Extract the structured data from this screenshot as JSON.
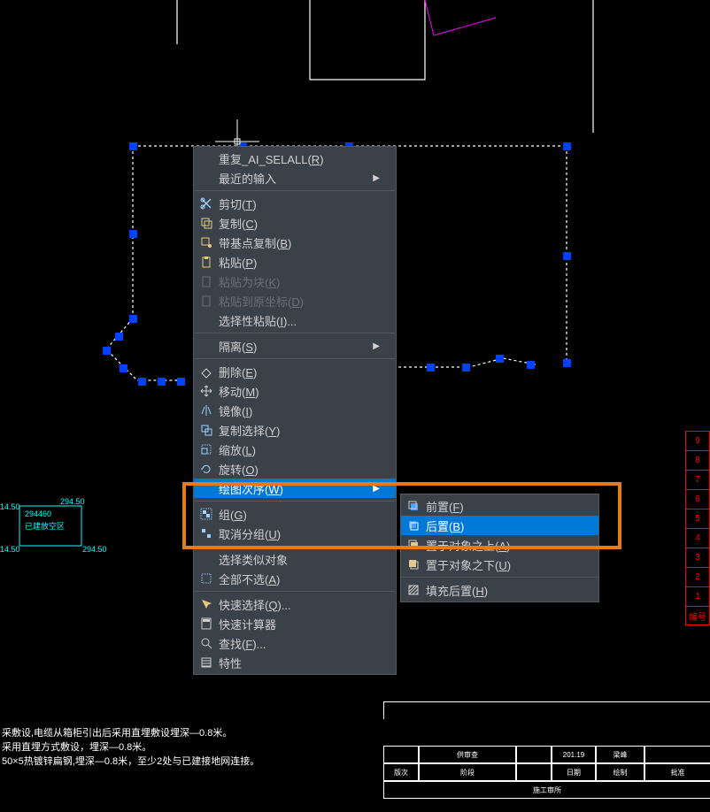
{
  "main_menu": {
    "items": [
      {
        "label": "重复_AI_SELALL",
        "hotkey": "R",
        "icon": "",
        "disabled": false,
        "arrow": false
      },
      {
        "label": "最近的输入",
        "hotkey": "",
        "icon": "",
        "disabled": false,
        "arrow": true
      },
      {
        "sep": true
      },
      {
        "label": "剪切",
        "hotkey": "T",
        "icon": "cut",
        "disabled": false
      },
      {
        "label": "复制",
        "hotkey": "C",
        "icon": "copy",
        "disabled": false
      },
      {
        "label": "带基点复制",
        "hotkey": "B",
        "icon": "copy-base",
        "disabled": false
      },
      {
        "label": "粘贴",
        "hotkey": "P",
        "icon": "paste",
        "disabled": false
      },
      {
        "label": "粘贴为块",
        "hotkey": "K",
        "icon": "paste-block",
        "disabled": true
      },
      {
        "label": "粘贴到原坐标",
        "hotkey": "D",
        "icon": "paste-coord",
        "disabled": true
      },
      {
        "label": "选择性粘贴",
        "hotkey": "I",
        "icon": "",
        "suffix": "...",
        "disabled": false
      },
      {
        "sep": true
      },
      {
        "label": "隔离",
        "hotkey": "S",
        "icon": "",
        "arrow": true
      },
      {
        "sep": true
      },
      {
        "label": "删除",
        "hotkey": "E",
        "icon": "eraser",
        "disabled": false
      },
      {
        "label": "移动",
        "hotkey": "M",
        "icon": "move",
        "disabled": false
      },
      {
        "label": "镜像",
        "hotkey": "I",
        "icon": "mirror",
        "disabled": false
      },
      {
        "label": "复制选择",
        "hotkey": "Y",
        "icon": "copysel",
        "disabled": false
      },
      {
        "label": "缩放",
        "hotkey": "L",
        "icon": "scale",
        "disabled": false
      },
      {
        "label": "旋转",
        "hotkey": "O",
        "icon": "rotate",
        "disabled": false
      },
      {
        "label": "绘图次序",
        "hotkey": "W",
        "icon": "",
        "arrow": true,
        "highlighted": true
      },
      {
        "sep": true
      },
      {
        "label": "组",
        "hotkey": "G",
        "icon": "group",
        "disabled": false
      },
      {
        "label": "取消分组",
        "hotkey": "U",
        "icon": "ungroup",
        "disabled": false
      },
      {
        "sep": true
      },
      {
        "label": "选择类似对象",
        "hotkey": "",
        "icon": "",
        "disabled": false
      },
      {
        "label": "全部不选",
        "hotkey": "A",
        "icon": "deselect",
        "disabled": false
      },
      {
        "sep": true
      },
      {
        "label": "快速选择",
        "hotkey": "Q",
        "icon": "quickselect",
        "suffix": "...",
        "disabled": false
      },
      {
        "label": "快速计算器",
        "hotkey": "",
        "icon": "calc",
        "disabled": false
      },
      {
        "label": "查找",
        "hotkey": "F",
        "icon": "find",
        "suffix": "...",
        "disabled": false
      },
      {
        "label": "特性",
        "hotkey": "",
        "icon": "props",
        "disabled": false
      }
    ]
  },
  "sub_menu": {
    "items": [
      {
        "label": "前置",
        "hotkey": "F",
        "icon": "front"
      },
      {
        "label": "后置",
        "hotkey": "B",
        "icon": "back",
        "highlighted": true
      },
      {
        "label": "置于对象之上",
        "hotkey": "A",
        "icon": "above"
      },
      {
        "label": "置于对象之下",
        "hotkey": "U",
        "icon": "below"
      },
      {
        "sep": true
      },
      {
        "label": "填充后置",
        "hotkey": "H",
        "icon": "hatchback"
      }
    ]
  },
  "side_numbers": [
    "9",
    "8",
    "7",
    "6",
    "5",
    "4",
    "3",
    "2",
    "1",
    "编号"
  ],
  "bottom_text": {
    "line1": "采敷设,电缆从箱柜引出后采用直埋敷设埋深—0.8米。",
    "line2": "采用直埋方式敷设，埋深—0.8米。",
    "line3": "50×5热镀锌扁钢,埋深—0.8米，至少2处与已建接地网连接。"
  },
  "dim_labels": {
    "l1": "14.50",
    "l2": "294460",
    "l3": "已建放空区",
    "l4": "14.50",
    "l5": "294.50",
    "l6": "294.50"
  },
  "title_block": {
    "row1": [
      "",
      "供审查",
      "",
      "201.19",
      "梁峰",
      ""
    ],
    "row2": [
      "版次",
      "",
      "阶段",
      "",
      "日期",
      "绘制",
      "批准"
    ],
    "row3": "施工审所"
  }
}
